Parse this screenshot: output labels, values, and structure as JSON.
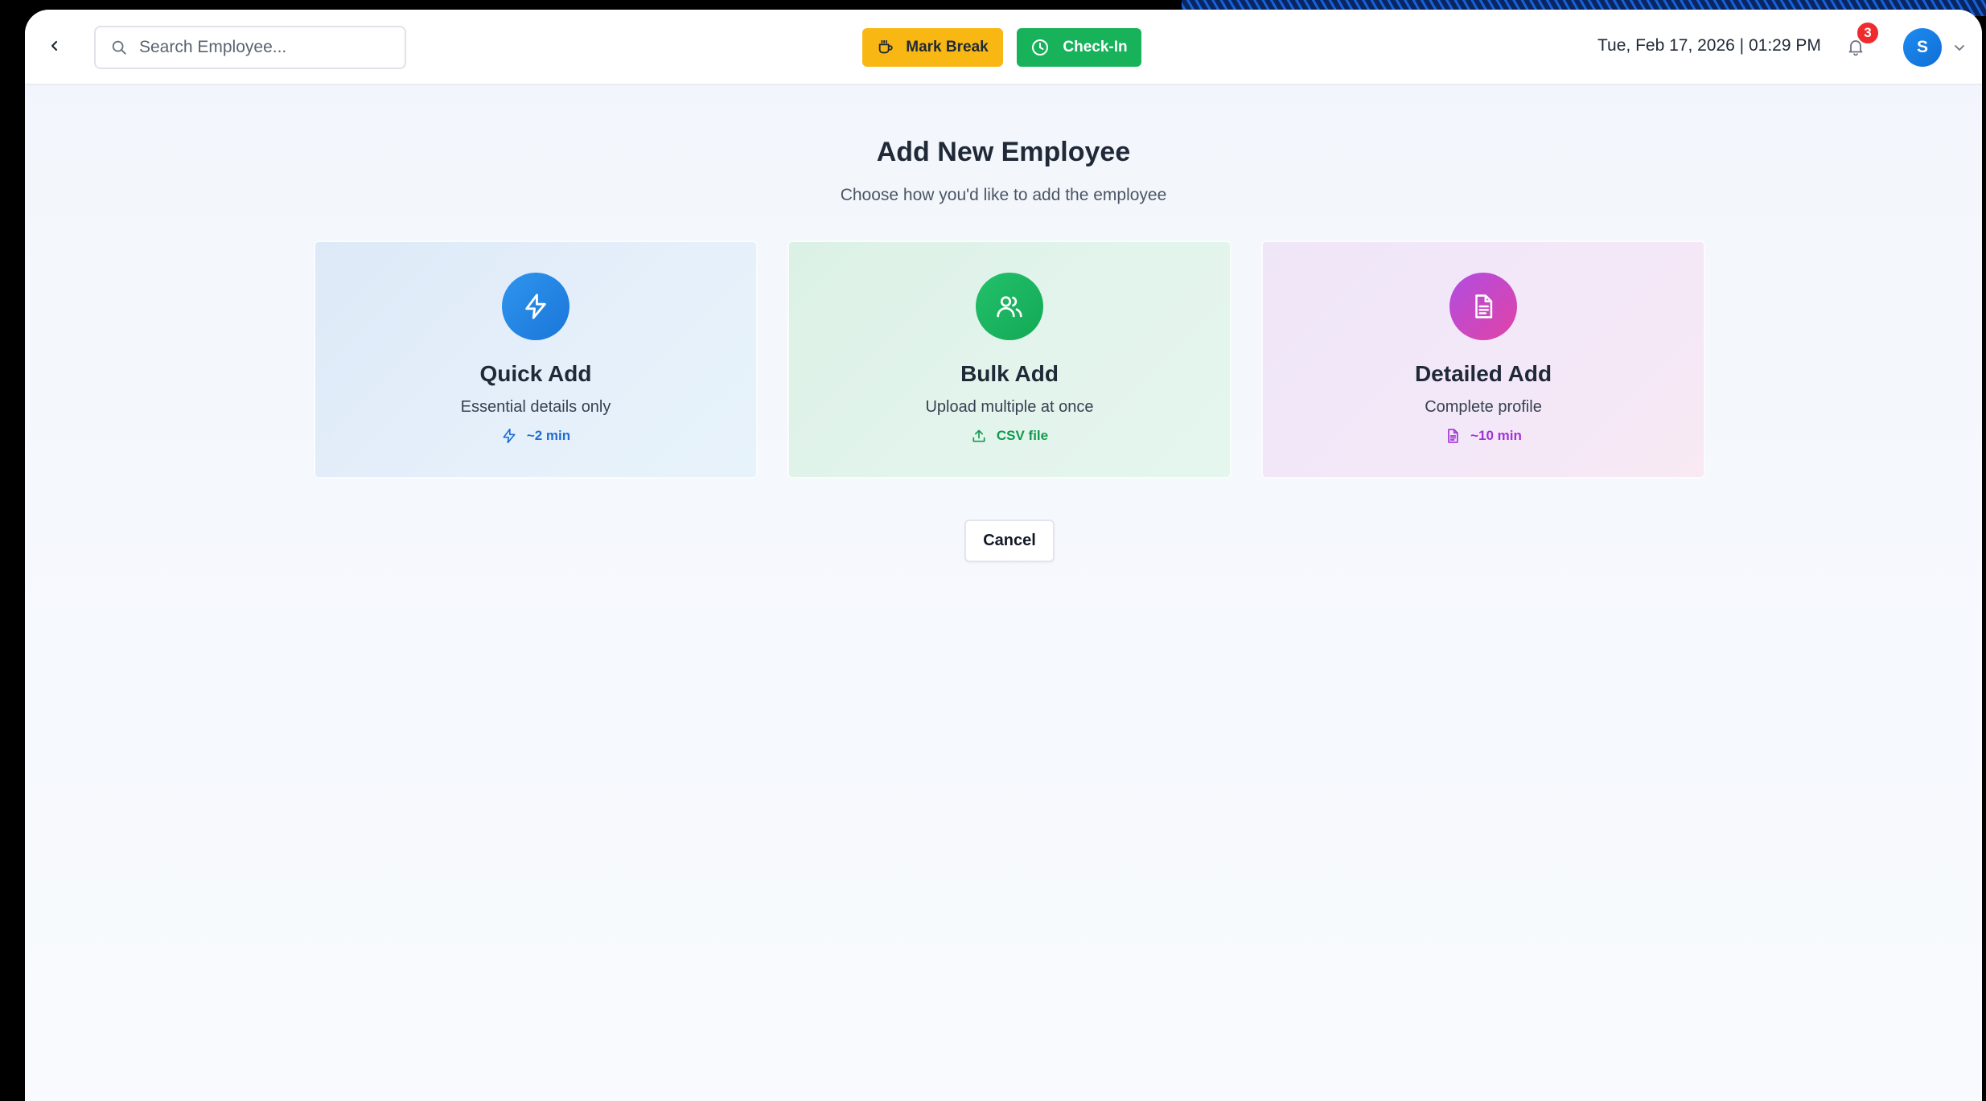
{
  "header": {
    "search_placeholder": "Search Employee...",
    "mark_break_label": "Mark Break",
    "check_in_label": "Check-In",
    "datetime": "Tue, Feb 17, 2026 | 01:29 PM",
    "notification_count": "3",
    "avatar_initial": "S"
  },
  "main": {
    "title": "Add New Employee",
    "subtitle": "Choose how you'd like to add the employee",
    "options": [
      {
        "title": "Quick Add",
        "description": "Essential details only",
        "meta": "~2 min",
        "icon": "lightning-icon",
        "meta_icon": "lightning-icon"
      },
      {
        "title": "Bulk Add",
        "description": "Upload multiple at once",
        "meta": "CSV file",
        "icon": "users-icon",
        "meta_icon": "upload-icon"
      },
      {
        "title": "Detailed Add",
        "description": "Complete profile",
        "meta": "~10 min",
        "icon": "document-icon",
        "meta_icon": "document-icon"
      }
    ],
    "cancel_label": "Cancel"
  },
  "colors": {
    "mark_break": "#f8b712",
    "check_in": "#18b25a",
    "quick_accent": "#1d6fd6",
    "bulk_accent": "#129a4c",
    "detailed_accent": "#a233d6",
    "badge": "#ef2b2d"
  }
}
